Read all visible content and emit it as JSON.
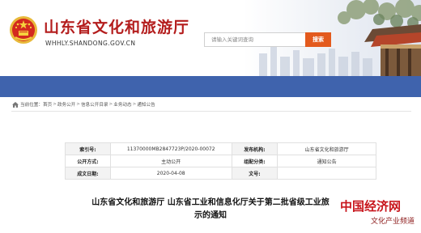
{
  "header": {
    "title": "山东省文化和旅游厅",
    "domain": "WHHLY.SHANDONG.GOV.CN",
    "search_placeholder": "请输入关键词查询",
    "search_button": "搜索"
  },
  "breadcrumb": {
    "prefix": "当前位置：",
    "items": [
      "首页",
      "政务公开",
      "信息公开目录",
      "业务动态",
      "通知公告"
    ],
    "separator": ">"
  },
  "info_table": {
    "rows": [
      {
        "l1": "索引号:",
        "v1": "11370000MB2847723P/2020-00072",
        "l2": "发布机构:",
        "v2": "山东省文化和旅游厅"
      },
      {
        "l1": "公开方式:",
        "v1": "主动公开",
        "l2": "组配分类:",
        "v2": "通知公告"
      },
      {
        "l1": "成文日期:",
        "v1": "2020-04-08",
        "l2": "文号:",
        "v2": ""
      }
    ]
  },
  "article": {
    "title_line1": "山东省文化和旅游厅 山东省工业和信息化厅关于第二批省级工业旅",
    "title_line2": "示的通知"
  },
  "watermark": {
    "brand": "中国经济网",
    "sub": "文化产业频道"
  },
  "colors": {
    "brand_red": "#b41d1d",
    "nav_blue": "#3f63ad",
    "search_orange": "#e35a1d"
  }
}
